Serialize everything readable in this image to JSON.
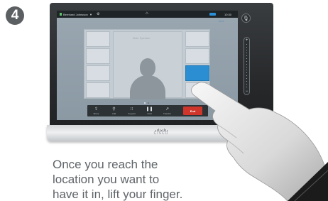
{
  "step": {
    "number": "4"
  },
  "screen": {
    "status": {
      "user": "Bernhard Johnsson",
      "caret": "▼",
      "home": "⌂",
      "time": "10:30"
    },
    "tile_caption": "Main Speaker",
    "small_label": "00:00",
    "call_bar": [
      {
        "label": "Share",
        "icon": "⇪"
      },
      {
        "label": "Add",
        "icon": "⚲"
      },
      {
        "label": "Keypad",
        "icon": "⁝⁝"
      },
      {
        "label": "Hold",
        "icon": "❚❚"
      },
      {
        "label": "Transfer",
        "icon": "↗"
      }
    ],
    "end_label": "End",
    "mic_icon": "🎤",
    "volume": {
      "plus": "+",
      "minus": "−"
    }
  },
  "brand": {
    "logo_text": "CISCO"
  },
  "instruction": {
    "line1": "Once you reach the",
    "line2": "location you want to",
    "line3": "have it in, lift your finger."
  },
  "colors": {
    "accent_blue": "#2b8ed3",
    "end_red": "#d0352b",
    "step_badge": "#5c5f62",
    "text_gray": "#5f6468"
  }
}
